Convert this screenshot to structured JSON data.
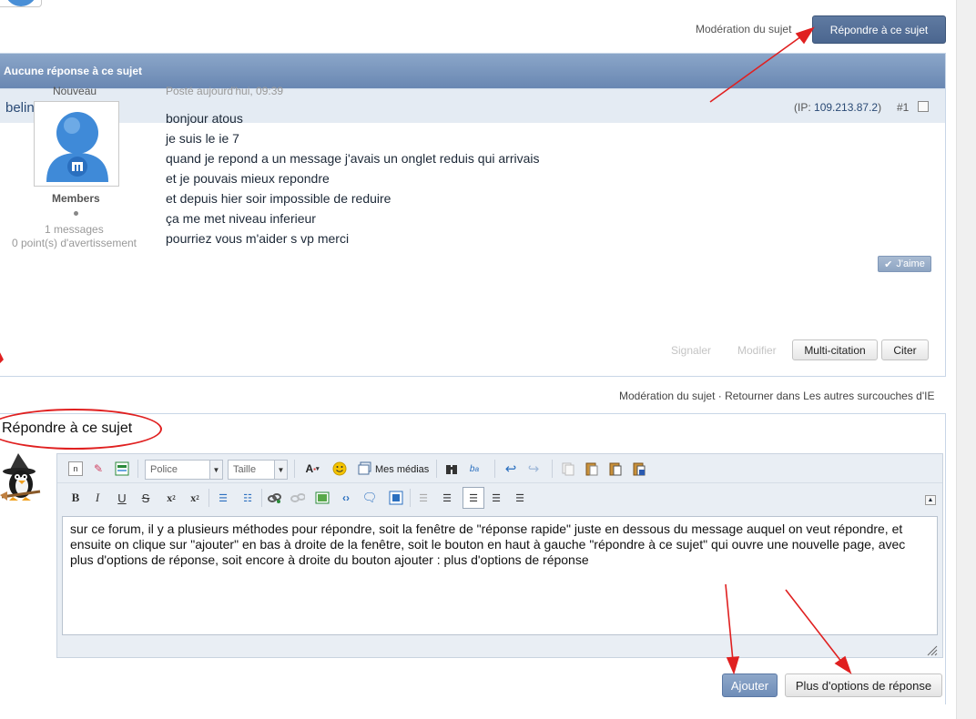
{
  "header": {
    "moderation_link": "Modération du sujet",
    "reply_button": "Répondre à ce sujet"
  },
  "post_block": {
    "title": "Aucune réponse à ce sujet",
    "author": "belinda",
    "ip_label": "(IP: ",
    "ip_value": "109.213.87.2",
    "ip_close": ")",
    "post_number": "#1",
    "rank": "Nouveau",
    "group": "Members",
    "message_count": "1 messages",
    "warning_points": "0 point(s) d'avertissement",
    "posted": "Posté aujourd'hui, 09:39",
    "body": [
      "bonjour atous",
      "je suis le ie 7",
      "quand je repond a un message j'avais un onglet  reduis qui arrivais",
      "et je pouvais mieux repondre",
      "et depuis hier soir impossible de reduire",
      "ça me met niveau inferieur",
      "pourriez vous m'aider  s vp merci"
    ],
    "like_label": "J'aime",
    "actions": {
      "report": "Signaler",
      "edit": "Modifier",
      "multiquote": "Multi-citation",
      "quote": "Citer"
    }
  },
  "bottom_links": "Modération du sujet · Retourner dans Les autres surcouches d'IE",
  "reply": {
    "title": "Répondre à ce sujet",
    "toolbar": {
      "font_placeholder": "Police",
      "size_placeholder": "Taille",
      "medias_label": "Mes médias"
    },
    "text": "sur ce forum, il y a plusieurs  méthodes  pour répondre, soit la fenêtre de \"réponse rapide\" juste en dessous du message auquel on veut répondre, et ensuite on clique sur \"ajouter\" en bas à droite de la fenêtre, soit le bouton en haut à gauche \"répondre à ce sujet\" qui ouvre une nouvelle page, avec plus d'options de réponse, soit encore à droite du bouton ajouter : plus d'options de réponse",
    "add_button": "Ajouter",
    "more_options_button": "Plus d'options de réponse"
  },
  "colors": {
    "accent": "#4b668f",
    "annotation": "#e02020",
    "link": "#2a4a75"
  }
}
